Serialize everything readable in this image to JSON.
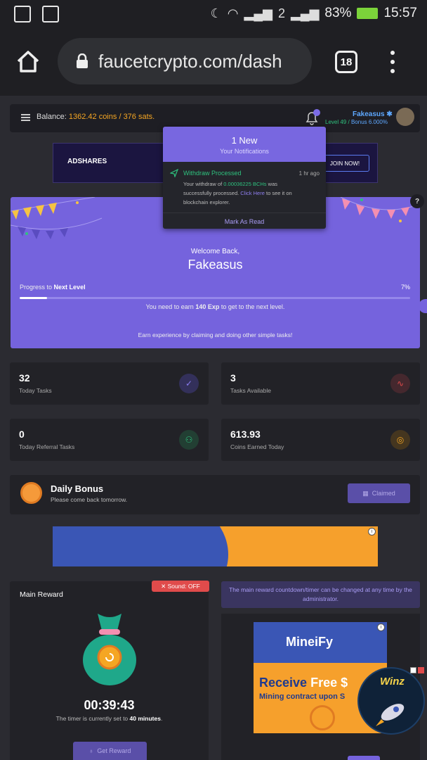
{
  "status_bar": {
    "battery": "83%",
    "time": "15:57",
    "sim_badge": "2"
  },
  "browser": {
    "url": "faucetcrypto.com/dash",
    "tab_count": "18"
  },
  "header": {
    "balance_label": "Balance:",
    "coins": "1362.42 coins",
    "separator": "/",
    "sats": "376 sats.",
    "username": "Fakeasus",
    "level": "Level 49",
    "bonus_sep": "/",
    "bonus": "Bonus 6.000%"
  },
  "notifications": {
    "count_title": "1 New",
    "subtitle": "Your Notifications",
    "item": {
      "title": "Withdraw Processed",
      "time": "1 hr ago",
      "text_prefix": "Your withdraw of",
      "amount": "0.00036225 BCHs",
      "text_middle": "was successfully processed.",
      "link": "Click Here",
      "text_suffix": "to see it on blockchain explorer."
    },
    "mark_read": "Mark As Read"
  },
  "ad_top": {
    "brand": "ADSHARES",
    "cta": "JOIN NOW!"
  },
  "welcome": {
    "greeting": "Welcome Back,",
    "name": "Fakeasus",
    "progress_prefix": "Progress to",
    "progress_target": "Next Level",
    "progress_pct": "7%",
    "progress_value": 0.07,
    "need_prefix": "You need to earn",
    "need_amount": "140 Exp",
    "need_suffix": "to get to the next level.",
    "earn_note": "Earn experience by claiming and doing other simple tasks!"
  },
  "help_label": "?",
  "stats": [
    {
      "value": "32",
      "label": "Today Tasks",
      "icon": "check-icon",
      "color": "#6a5acd"
    },
    {
      "value": "3",
      "label": "Tasks Available",
      "icon": "pulse-icon",
      "color": "#e04b4b"
    },
    {
      "value": "0",
      "label": "Today Referral Tasks",
      "icon": "users-icon",
      "color": "#2ec27e"
    },
    {
      "value": "613.93",
      "label": "Coins Earned Today",
      "icon": "coin-icon",
      "color": "#f5a623"
    }
  ],
  "daily_bonus": {
    "title": "Daily Bonus",
    "subtitle": "Please come back tomorrow.",
    "button": "Claimed"
  },
  "main_reward": {
    "title": "Main Reward",
    "sound": "Sound: OFF",
    "timer": "00:39:43",
    "note_prefix": "The timer is currently set to",
    "note_value": "40 minutes",
    "note_suffix": ".",
    "button": "Get Reward"
  },
  "info_note": "The main reward countdown/timer can be changed at any time by the administrator.",
  "ad_mineify": {
    "brand": "MineiFy",
    "headline_a": "Receive",
    "headline_b": "Free $",
    "sub": "Mining contract upon S"
  },
  "winz": {
    "label": "Winz"
  },
  "colors": {
    "accent": "#7563dd",
    "orange": "#f5a623",
    "green": "#2ec27e",
    "link": "#5ea8ff"
  }
}
